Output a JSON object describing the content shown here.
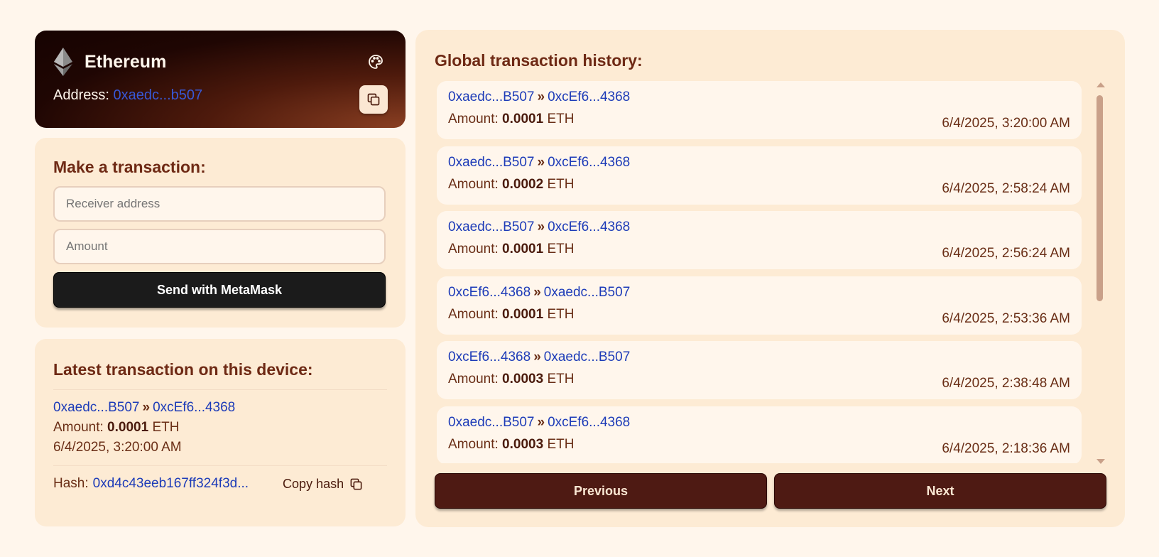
{
  "wallet": {
    "name": "Ethereum",
    "address_label": "Address:",
    "address_value": "0xaedc...b507",
    "icons": {
      "logo": "ethereum-icon",
      "palette": "palette-icon",
      "copy": "copy-icon"
    }
  },
  "tx_form": {
    "title": "Make a transaction:",
    "receiver_placeholder": "Receiver address",
    "amount_placeholder": "Amount",
    "send_label": "Send with MetaMask"
  },
  "latest": {
    "title": "Latest transaction on this device:",
    "from": "0xaedc...B507",
    "separator": "»",
    "to": "0xcEf6...4368",
    "amount_label": "Amount:",
    "amount_value": "0.0001",
    "amount_unit": "ETH",
    "time": "6/4/2025, 3:20:00 AM",
    "hash_label": "Hash:",
    "hash_value": "0xd4c43eeb167ff324f3d...",
    "copy_hash_label": "Copy hash"
  },
  "history": {
    "title": "Global transaction history:",
    "amount_label": "Amount:",
    "unit": "ETH",
    "separator": "»",
    "items": [
      {
        "from": "0xaedc...B507",
        "to": "0xcEf6...4368",
        "amount": "0.0001",
        "time": "6/4/2025, 3:20:00 AM"
      },
      {
        "from": "0xaedc...B507",
        "to": "0xcEf6...4368",
        "amount": "0.0002",
        "time": "6/4/2025, 2:58:24 AM"
      },
      {
        "from": "0xaedc...B507",
        "to": "0xcEf6...4368",
        "amount": "0.0001",
        "time": "6/4/2025, 2:56:24 AM"
      },
      {
        "from": "0xcEf6...4368",
        "to": "0xaedc...B507",
        "amount": "0.0001",
        "time": "6/4/2025, 2:53:36 AM"
      },
      {
        "from": "0xcEf6...4368",
        "to": "0xaedc...B507",
        "amount": "0.0003",
        "time": "6/4/2025, 2:38:48 AM"
      },
      {
        "from": "0xaedc...B507",
        "to": "0xcEf6...4368",
        "amount": "0.0003",
        "time": "6/4/2025, 2:18:36 AM"
      }
    ],
    "previous_label": "Previous",
    "next_label": "Next"
  },
  "colors": {
    "background": "#fff6ec",
    "panel": "#fdebd4",
    "accent_dark": "#4e1a13",
    "link": "#1d3bb8",
    "heading": "#6e2914"
  }
}
